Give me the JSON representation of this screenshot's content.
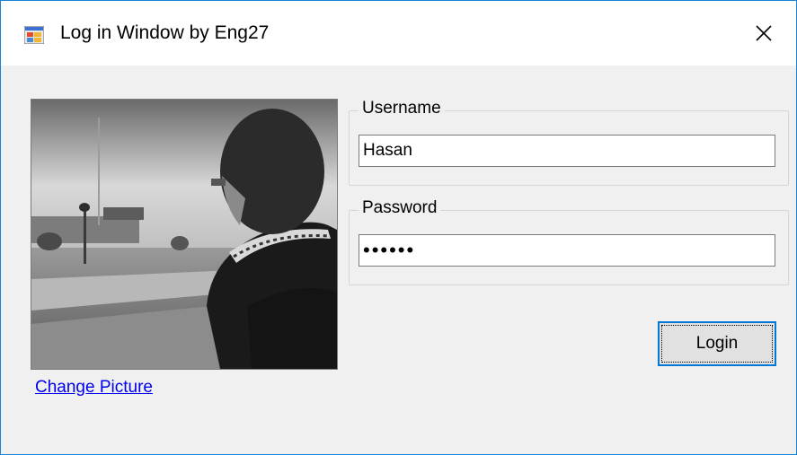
{
  "window": {
    "title": "Log in Window by Eng27",
    "icon": "winforms-app-icon",
    "close_icon": "close-x-icon"
  },
  "profile": {
    "image": "profile-photo",
    "change_picture_label": "Change Picture"
  },
  "form": {
    "username_label": "Username",
    "username_value": "Hasan",
    "password_label": "Password",
    "password_value": "••••••",
    "login_label": "Login"
  },
  "colors": {
    "accent": "#0078d7",
    "link": "#0000ee",
    "window_border": "#1883d7"
  }
}
